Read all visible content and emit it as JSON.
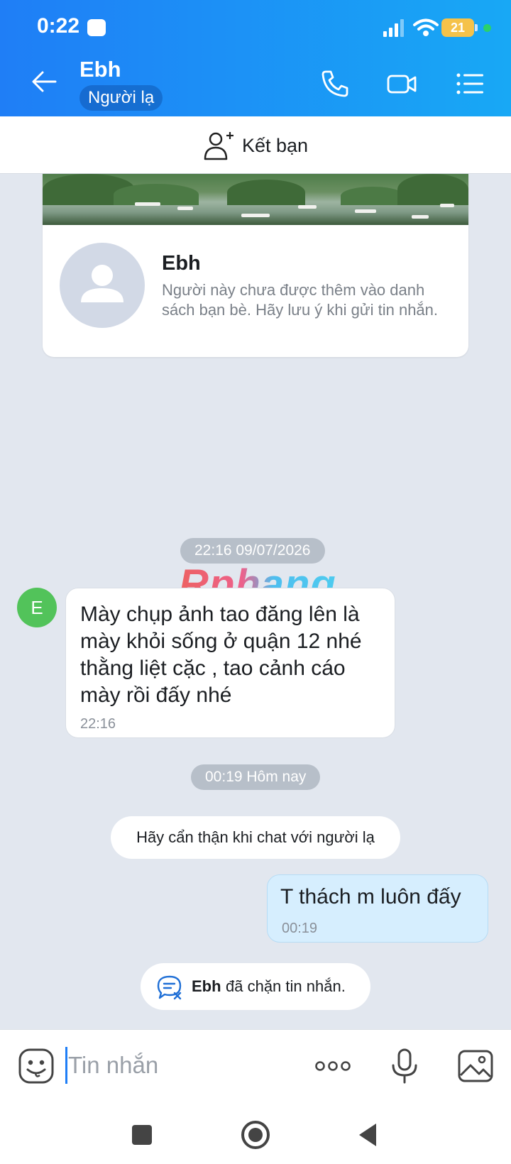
{
  "status_bar": {
    "time": "0:22",
    "battery": "21"
  },
  "header": {
    "contact_name": "Ebh",
    "badge": "Người lạ"
  },
  "add_friend": {
    "label": "Kết bạn"
  },
  "profile_card": {
    "name": "Ebh",
    "description": "Người này chưa được thêm vào danh sách bạn bè. Hãy lưu ý khi gửi tin nhắn."
  },
  "messages": {
    "timestamp_1": "22:16 09/07/2026",
    "watermark": "Rphang",
    "avatar_letter": "E",
    "incoming": {
      "text": "Mày chụp ảnh tao đăng lên là mày khỏi sống ở quận 12 nhé thằng liệt cặc , tao cảnh cáo mày rồi đấy nhé",
      "time": "22:16"
    },
    "timestamp_2": "00:19 Hôm nay",
    "system_note": "Hãy cẩn thận khi chat với người lạ",
    "outgoing": {
      "text": "T thách m luôn đấy",
      "time": "00:19"
    },
    "blocked": {
      "name": "Ebh",
      "text": "đã chặn tin nhắn."
    }
  },
  "composer": {
    "placeholder": "Tin nhắn"
  },
  "colors": {
    "header_start": "#1f7ef6",
    "header_end": "#18a8f5",
    "outgoing_bubble": "#d6eefe",
    "chat_bg": "#e2e7ef"
  },
  "icons": [
    "back-arrow-icon",
    "phone-icon",
    "video-call-icon",
    "menu-list-icon",
    "add-friend-icon",
    "blocked-chat-icon",
    "emoji-icon",
    "more-dots-icon",
    "microphone-icon",
    "image-icon"
  ]
}
